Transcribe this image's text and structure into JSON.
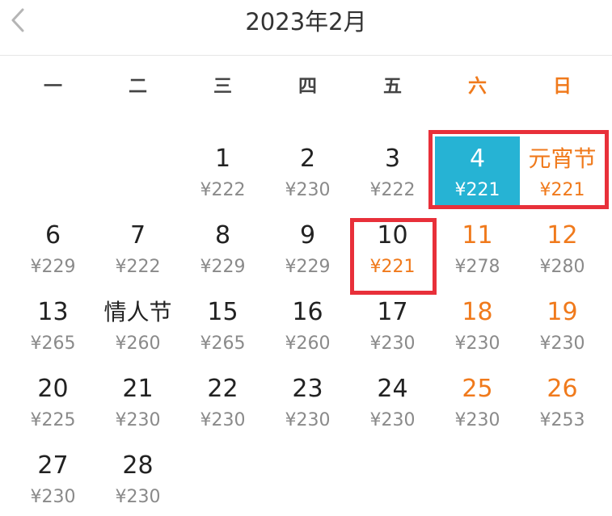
{
  "header": {
    "title": "2023年2月"
  },
  "weekdays": [
    "一",
    "二",
    "三",
    "四",
    "五",
    "六",
    "日"
  ],
  "weeks": [
    [
      null,
      null,
      {
        "day": "1",
        "price": "¥222"
      },
      {
        "day": "2",
        "price": "¥230"
      },
      {
        "day": "3",
        "price": "¥222"
      },
      {
        "day": "4",
        "price": "¥221",
        "selected": true
      },
      {
        "day": "元宵节",
        "price": "¥221",
        "holiday": true
      }
    ],
    [
      {
        "day": "6",
        "price": "¥229"
      },
      {
        "day": "7",
        "price": "¥222"
      },
      {
        "day": "8",
        "price": "¥229"
      },
      {
        "day": "9",
        "price": "¥229"
      },
      {
        "day": "10",
        "price": "¥221",
        "promo": true
      },
      {
        "day": "11",
        "price": "¥278"
      },
      {
        "day": "12",
        "price": "¥280"
      }
    ],
    [
      {
        "day": "13",
        "price": "¥265"
      },
      {
        "day": "情人节",
        "price": "¥260",
        "holiday": true
      },
      {
        "day": "15",
        "price": "¥265"
      },
      {
        "day": "16",
        "price": "¥260"
      },
      {
        "day": "17",
        "price": "¥230"
      },
      {
        "day": "18",
        "price": "¥230"
      },
      {
        "day": "19",
        "price": "¥230"
      }
    ],
    [
      {
        "day": "20",
        "price": "¥225"
      },
      {
        "day": "21",
        "price": "¥230"
      },
      {
        "day": "22",
        "price": "¥230"
      },
      {
        "day": "23",
        "price": "¥230"
      },
      {
        "day": "24",
        "price": "¥230"
      },
      {
        "day": "25",
        "price": "¥230"
      },
      {
        "day": "26",
        "price": "¥253"
      }
    ],
    [
      {
        "day": "27",
        "price": "¥230"
      },
      {
        "day": "28",
        "price": "¥230"
      },
      null,
      null,
      null,
      null,
      null
    ]
  ],
  "colors": {
    "selected_bg": "#26b3d4",
    "weekend": "#f07a1c",
    "highlight_border": "#e8303a"
  }
}
